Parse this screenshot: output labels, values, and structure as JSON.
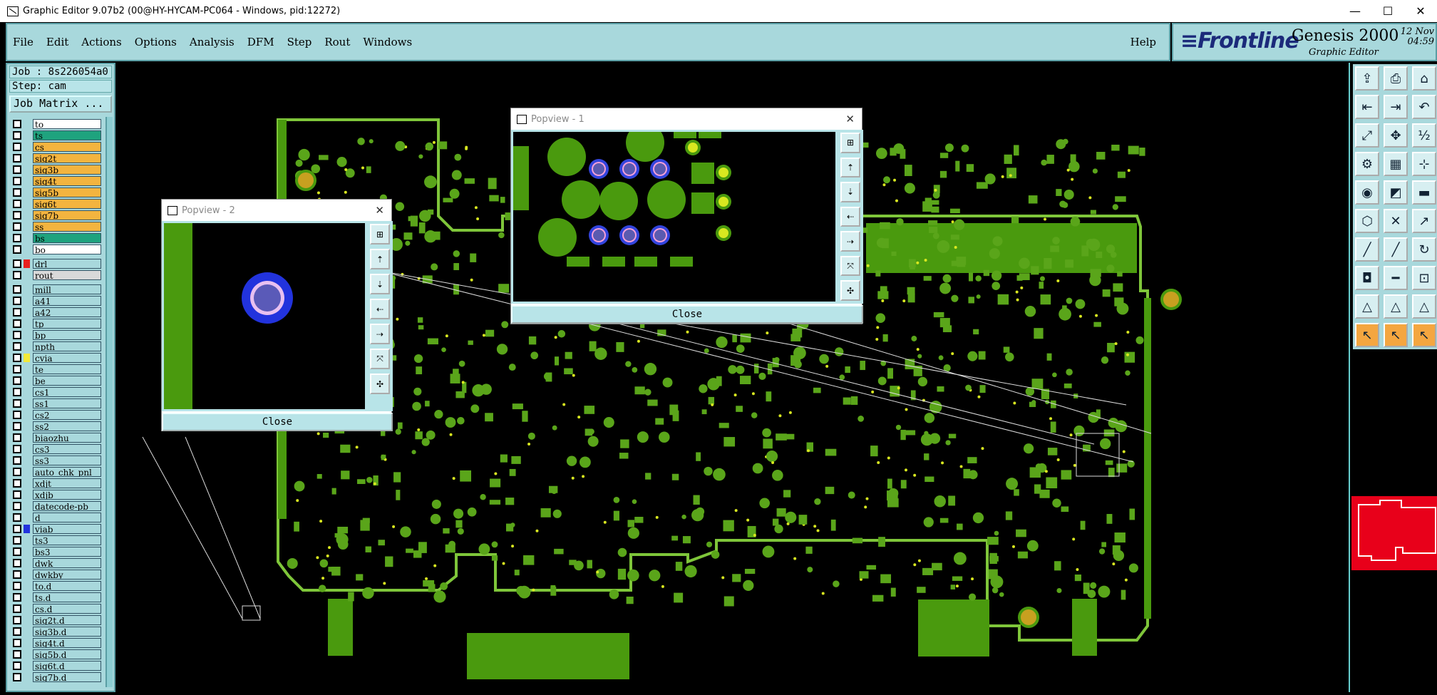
{
  "window": {
    "title": "Graphic Editor 9.07b2 (00@HY-HYCAM-PC064 - Windows, pid:12272)",
    "min": "—",
    "max": "☐",
    "close": "✕"
  },
  "menu": {
    "items": [
      "File",
      "Edit",
      "Actions",
      "Options",
      "Analysis",
      "DFM",
      "Step",
      "Rout",
      "Windows"
    ],
    "help": "Help"
  },
  "brand": {
    "logo_a": "Frontline",
    "product": "Genesis 2000",
    "subtitle": "Graphic Editor",
    "date_day": "12 Nov",
    "date_time": "04:59"
  },
  "job": {
    "job_label": "Job : 8s226054a0",
    "step_label": "Step: cam",
    "matrix_button": "Job Matrix ..."
  },
  "layers": [
    {
      "name": "to",
      "color": "#ffffff"
    },
    {
      "name": "ts",
      "color": "#1fa37e"
    },
    {
      "name": "cs",
      "color": "#f3b43f"
    },
    {
      "name": "sig2t",
      "color": "#f3b43f"
    },
    {
      "name": "sig3b",
      "color": "#f3b43f"
    },
    {
      "name": "sig4t",
      "color": "#f3b43f"
    },
    {
      "name": "sig5b",
      "color": "#f3b43f"
    },
    {
      "name": "sig6t",
      "color": "#f3b43f"
    },
    {
      "name": "sig7b",
      "color": "#f3b43f"
    },
    {
      "name": "ss",
      "color": "#f3b43f"
    },
    {
      "name": "bs",
      "color": "#1fa37e"
    },
    {
      "name": "bo",
      "color": "#ffffff"
    },
    {
      "name": "drl",
      "color": "#a8d8dc",
      "swatch": "#e8201e",
      "sep": true
    },
    {
      "name": "rout",
      "color": "#d9d9d9"
    },
    {
      "name": "mill",
      "color": "#a8d8dc",
      "sep": true
    },
    {
      "name": "a41",
      "color": "#a8d8dc"
    },
    {
      "name": "a42",
      "color": "#a8d8dc"
    },
    {
      "name": "tp",
      "color": "#a8d8dc"
    },
    {
      "name": "bp",
      "color": "#a8d8dc"
    },
    {
      "name": "npth",
      "color": "#a8d8dc"
    },
    {
      "name": "cvia",
      "color": "#a8d8dc",
      "swatch": "#f2ea3a"
    },
    {
      "name": "te",
      "color": "#a8d8dc"
    },
    {
      "name": "be",
      "color": "#a8d8dc"
    },
    {
      "name": "cs1",
      "color": "#a8d8dc"
    },
    {
      "name": "ss1",
      "color": "#a8d8dc"
    },
    {
      "name": "cs2",
      "color": "#a8d8dc"
    },
    {
      "name": "ss2",
      "color": "#a8d8dc"
    },
    {
      "name": "biaozhu",
      "color": "#a8d8dc"
    },
    {
      "name": "cs3",
      "color": "#a8d8dc"
    },
    {
      "name": "ss3",
      "color": "#a8d8dc"
    },
    {
      "name": "auto_chk_pnl",
      "color": "#a8d8dc"
    },
    {
      "name": "xdjt",
      "color": "#a8d8dc"
    },
    {
      "name": "xdjb",
      "color": "#a8d8dc"
    },
    {
      "name": "datecode-pb",
      "color": "#a8d8dc"
    },
    {
      "name": "d",
      "color": "#a8d8dc"
    },
    {
      "name": "viab",
      "color": "#a8d8dc",
      "swatch": "#2233dd"
    },
    {
      "name": "ts3",
      "color": "#a8d8dc"
    },
    {
      "name": "bs3",
      "color": "#a8d8dc"
    },
    {
      "name": "dwk",
      "color": "#a8d8dc"
    },
    {
      "name": "dwkby",
      "color": "#a8d8dc"
    },
    {
      "name": "to.d",
      "color": "#a8d8dc"
    },
    {
      "name": "ts.d",
      "color": "#a8d8dc"
    },
    {
      "name": "cs.d",
      "color": "#a8d8dc"
    },
    {
      "name": "sig2t.d",
      "color": "#a8d8dc"
    },
    {
      "name": "sig3b.d",
      "color": "#a8d8dc"
    },
    {
      "name": "sig4t.d",
      "color": "#a8d8dc"
    },
    {
      "name": "sig5b.d",
      "color": "#a8d8dc"
    },
    {
      "name": "sig6t.d",
      "color": "#a8d8dc"
    },
    {
      "name": "sig7b.d",
      "color": "#a8d8dc"
    }
  ],
  "popup1": {
    "title": "Popview - 1",
    "close": "Close"
  },
  "popup2": {
    "title": "Popview - 2",
    "close": "Close"
  },
  "colors": {
    "board": "#4a9a0e",
    "outline": "#7fc63a",
    "pad": "#5aa51a",
    "via_ring": "#3344dd",
    "yellow": "#d8e820",
    "panel": "#a8d8dc"
  },
  "tools": {
    "group1": [
      "open-icon",
      "save-icon",
      "home-icon",
      "step-left-icon",
      "step-right-icon",
      "undo-icon",
      "zoom-fit-icon",
      "zoom-center-icon",
      "scale-icon",
      "gear-icon",
      "grid-icon",
      "snap-icon"
    ],
    "group2": [
      "camera-icon",
      "edit-icon",
      "measure-icon",
      "select-icon",
      "cross-icon",
      "route-icon",
      "line-icon",
      "line2-icon",
      "rotate-icon",
      "pad-icon",
      "dash-icon",
      "box-icon",
      "triangle-icon",
      "triangle2-icon",
      "triangle3-icon",
      "pointer-icon",
      "pointer2-icon",
      "pointer3-icon"
    ]
  }
}
